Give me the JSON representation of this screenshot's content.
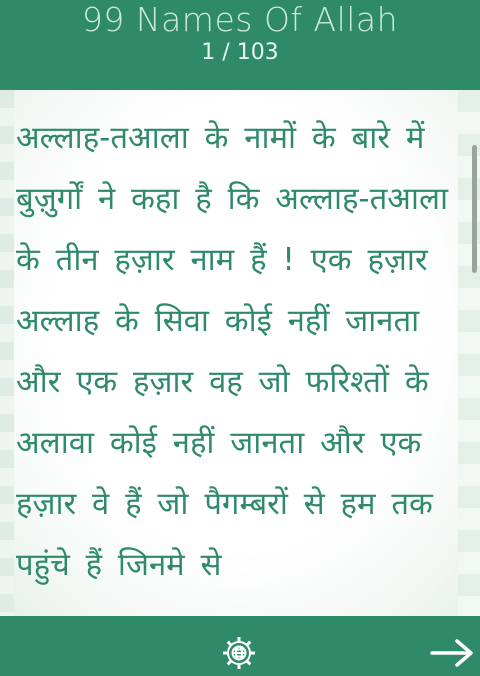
{
  "header": {
    "title": "99 Names Of Allah",
    "counter": "1 / 103"
  },
  "content": {
    "body_text": "अल्लाह-तआला के नामों के बारे में बुज़ुर्गों ने कहा है कि अल्लाह-तआला के तीन हज़ार नाम हैं ! एक हज़ार अल्लाह के सिवा कोई नहीं जानता और एक हज़ार वह जो फरिश्तों के अलावा कोई नहीं जानता और एक हज़ार वे हैं जो पैगम्बरों से हम तक पहुंचे हैं जिनमे से"
  },
  "footer": {
    "settings_icon": "gear-globe-icon",
    "next_icon": "arrow-right-icon"
  },
  "colors": {
    "primary": "#2e8a68",
    "text": "#2e8a68",
    "header_title": "#cfe8de"
  }
}
